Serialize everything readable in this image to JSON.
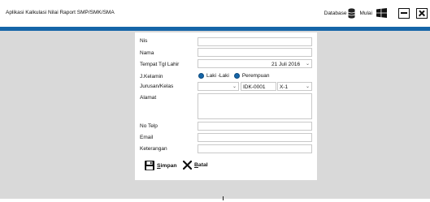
{
  "window": {
    "title": "Aplikasi Kalkulasi Nilai Raport SMP/SMK/SMA",
    "database_label": "Database",
    "mulai_label": "Mulai"
  },
  "form": {
    "labels": {
      "nis": "Nis",
      "nama": "Nama",
      "ttl": "Tempat Tgl Lahir",
      "jkel": "J.Kelamin",
      "jurusan": "Jurusan/Kelas",
      "alamat": "Alamat",
      "telp": "No Telp",
      "email": "Email",
      "ket": "Keterangan"
    },
    "values": {
      "nis": "",
      "nama": "",
      "tgl": "21 Juli 2016",
      "jurusan": "",
      "kode": "IDK-0001",
      "kelas": "X-1",
      "alamat": "",
      "telp": "",
      "email": "",
      "ket": ""
    },
    "gender": {
      "male": "Laki -Laki",
      "female": "Perempuan"
    },
    "buttons": {
      "save_first": "S",
      "save_rest": "impan",
      "cancel_first": "B",
      "cancel_rest": "atal"
    }
  },
  "colors": {
    "accent": "#1565a8",
    "background": "#d9d9d9"
  },
  "icons": [
    "database-icon",
    "windows-icon",
    "minimize-icon",
    "close-icon",
    "save-icon",
    "x-icon",
    "chevron-down-icon"
  ]
}
